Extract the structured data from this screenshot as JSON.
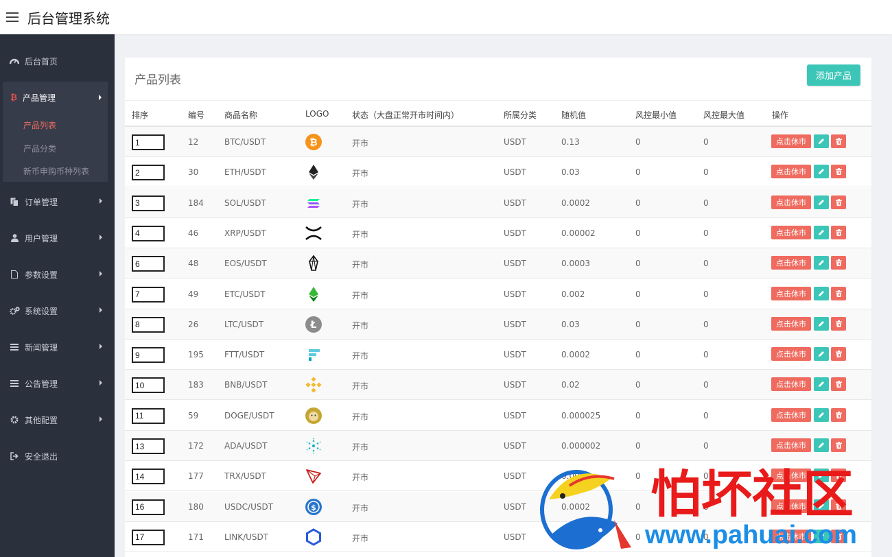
{
  "app": {
    "title": "后台管理系统"
  },
  "sidebar": {
    "items": [
      {
        "label": "后台首页",
        "icon": "dashboard-icon"
      },
      {
        "label": "产品管理",
        "icon": "bitcoin-icon",
        "active": true
      },
      {
        "label": "订单管理",
        "icon": "copy-icon"
      },
      {
        "label": "用户管理",
        "icon": "user-icon"
      },
      {
        "label": "参数设置",
        "icon": "file-icon"
      },
      {
        "label": "系统设置",
        "icon": "gears-icon"
      },
      {
        "label": "新闻管理",
        "icon": "list-icon"
      },
      {
        "label": "公告管理",
        "icon": "list-icon"
      },
      {
        "label": "其他配置",
        "icon": "gear-icon"
      },
      {
        "label": "安全退出",
        "icon": "sign-out-icon"
      }
    ],
    "sub_items": [
      {
        "label": "产品列表",
        "active": true
      },
      {
        "label": "产品分类"
      },
      {
        "label": "新币申购币种列表"
      }
    ]
  },
  "panel": {
    "title": "产品列表",
    "add_label": "添加产品",
    "headers": [
      "排序",
      "编号",
      "商品名称",
      "LOGO",
      "状态（大盘正常开市时间内）",
      "所属分类",
      "随机值",
      "风控最小值",
      "风控最大值",
      "操作"
    ],
    "close_label": "点击休市"
  },
  "rows": [
    {
      "sort": "1",
      "id": "12",
      "name": "BTC/USDT",
      "logo": "btc-logo",
      "status": "开市",
      "category": "USDT",
      "random": "0.13",
      "min": "0",
      "max": "0"
    },
    {
      "sort": "2",
      "id": "30",
      "name": "ETH/USDT",
      "logo": "eth-logo",
      "status": "开市",
      "category": "USDT",
      "random": "0.03",
      "min": "0",
      "max": "0"
    },
    {
      "sort": "3",
      "id": "184",
      "name": "SOL/USDT",
      "logo": "sol-logo",
      "status": "开市",
      "category": "USDT",
      "random": "0.0002",
      "min": "0",
      "max": "0"
    },
    {
      "sort": "4",
      "id": "46",
      "name": "XRP/USDT",
      "logo": "xrp-logo",
      "status": "开市",
      "category": "USDT",
      "random": "0.00002",
      "min": "0",
      "max": "0"
    },
    {
      "sort": "6",
      "id": "48",
      "name": "EOS/USDT",
      "logo": "eos-logo",
      "status": "开市",
      "category": "USDT",
      "random": "0.0003",
      "min": "0",
      "max": "0"
    },
    {
      "sort": "7",
      "id": "49",
      "name": "ETC/USDT",
      "logo": "etc-logo",
      "status": "开市",
      "category": "USDT",
      "random": "0.002",
      "min": "0",
      "max": "0"
    },
    {
      "sort": "8",
      "id": "26",
      "name": "LTC/USDT",
      "logo": "ltc-logo",
      "status": "开市",
      "category": "USDT",
      "random": "0.03",
      "min": "0",
      "max": "0"
    },
    {
      "sort": "9",
      "id": "195",
      "name": "FTT/USDT",
      "logo": "ftt-logo",
      "status": "开市",
      "category": "USDT",
      "random": "0.0002",
      "min": "0",
      "max": "0"
    },
    {
      "sort": "10",
      "id": "183",
      "name": "BNB/USDT",
      "logo": "bnb-logo",
      "status": "开市",
      "category": "USDT",
      "random": "0.02",
      "min": "0",
      "max": "0"
    },
    {
      "sort": "11",
      "id": "59",
      "name": "DOGE/USDT",
      "logo": "doge-logo",
      "status": "开市",
      "category": "USDT",
      "random": "0.000025",
      "min": "0",
      "max": "0"
    },
    {
      "sort": "13",
      "id": "172",
      "name": "ADA/USDT",
      "logo": "ada-logo",
      "status": "开市",
      "category": "USDT",
      "random": "0.000002",
      "min": "0",
      "max": "0"
    },
    {
      "sort": "14",
      "id": "177",
      "name": "TRX/USDT",
      "logo": "trx-logo",
      "status": "开市",
      "category": "USDT",
      "random": "0.0002",
      "min": "0",
      "max": "0"
    },
    {
      "sort": "16",
      "id": "180",
      "name": "USDC/USDT",
      "logo": "usdc-logo",
      "status": "开市",
      "category": "USDT",
      "random": "0.0002",
      "min": "0",
      "max": "0"
    },
    {
      "sort": "17",
      "id": "171",
      "name": "LINK/USDT",
      "logo": "link-logo",
      "status": "开市",
      "category": "USDT",
      "random": "0.0002",
      "min": "0",
      "max": "0"
    }
  ],
  "watermark": {
    "brand": "怕坏社区",
    "url": "www.pahuai.com"
  },
  "colors": {
    "sidebar_bg": "#2b303d",
    "accent_red": "#ef6b5f",
    "accent_teal": "#3cc6b8"
  }
}
